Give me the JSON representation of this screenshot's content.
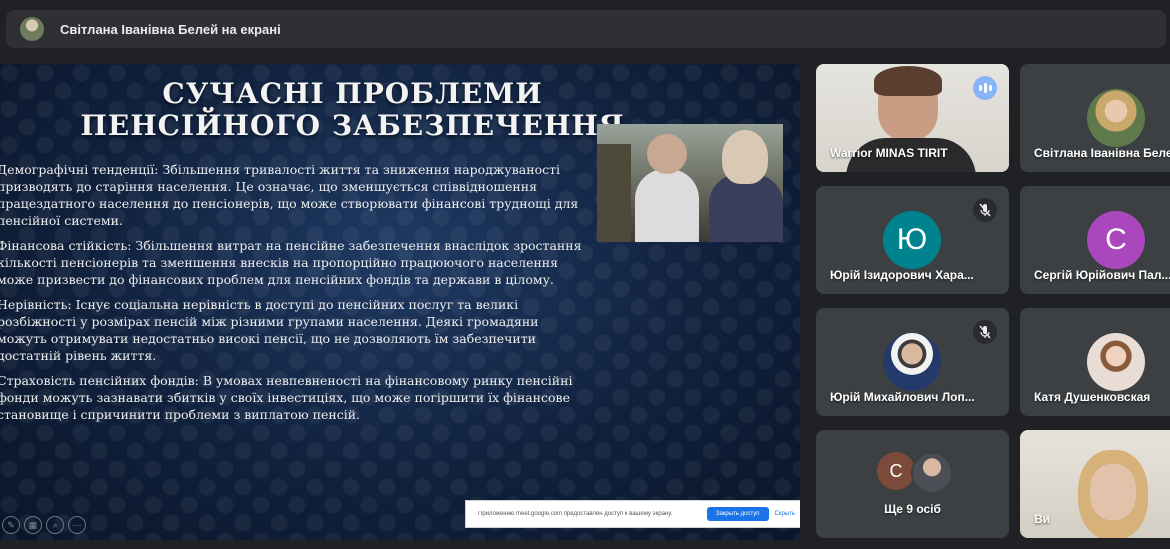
{
  "banner": {
    "title": "Світлана Іванівна Белей на екрані",
    "avatar_icon": "presenter-avatar"
  },
  "slide": {
    "title": "СУЧАСНІ ПРОБЛЕМИ ПЕНСІЙНОГО ЗАБЕЗПЕЧЕННЯ",
    "paragraphs": [
      "Демографічні тенденції: Збільшення тривалості життя та зниження народжуваності призводять до старіння населення. Це означає, що зменшується співвідношення працездатного населення до пенсіонерів, що може створювати фінансові труднощі для пенсійної системи.",
      "Фінансова стійкість: Збільшення витрат на пенсійне забезпечення внаслідок зростання кількості пенсіонерів та зменшення внесків на пропорційно працюючого населення може призвести до фінансових проблем для пенсійних фондів та держави в цілому.",
      "Нерівність: Існує соціальна нерівність в доступі до пенсійних послуг та великі розбіжності у розмірах пенсій між різними групами населення. Деякі громадяни можуть отримувати недостатньо високі пенсії, що не дозволяють їм забезпечити достатній рівень життя.",
      "Страховість пенсійних фондів: В умовах невпевненості на фінансовому ринку пенсійні фонди можуть зазнавати збитків у своїх інвестиціях, що може погіршити їх фінансове становище і спричинити проблеми з виплатою пенсій."
    ],
    "share_bar": {
      "message": "Приложению meet.google.com предоставлен доступ к вашему экрану.",
      "stop_label": "Закрыть доступ",
      "hide_label": "Скрыть"
    }
  },
  "participants": [
    {
      "name": "Warrior MINAS TIRIT",
      "speaking": true
    },
    {
      "name": "Світлана Іванівна Белей"
    },
    {
      "name": "Юрій Ізидорович Хара...",
      "letter": "Ю",
      "color": "#00838f",
      "muted": true
    },
    {
      "name": "Сергій Юрійович Пал...",
      "letter": "С",
      "color": "#ab47bc"
    },
    {
      "name": "Юрій Михайлович Лоп...",
      "muted": true
    },
    {
      "name": "Катя Душенковская"
    },
    {
      "name": "Ще 9 осіб",
      "letter": "С"
    },
    {
      "name": "Ви"
    }
  ]
}
